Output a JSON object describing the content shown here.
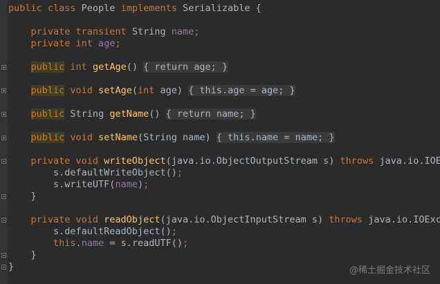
{
  "code": {
    "lines": [
      [
        {
          "t": "public class ",
          "c": "kw"
        },
        {
          "t": "People ",
          "c": "pl"
        },
        {
          "t": "implements ",
          "c": "kw"
        },
        {
          "t": "Serializable {",
          "c": "pl"
        }
      ],
      [],
      [
        {
          "t": "    private transient ",
          "c": "kw"
        },
        {
          "t": "String ",
          "c": "pl"
        },
        {
          "t": "name",
          "c": "fld"
        },
        {
          "t": ";",
          "c": "kw"
        }
      ],
      [
        {
          "t": "    private int ",
          "c": "kw"
        },
        {
          "t": "age",
          "c": "fld"
        },
        {
          "t": ";",
          "c": "kw"
        }
      ],
      [],
      [
        {
          "t": "    ",
          "c": "pl"
        },
        {
          "t": "public",
          "c": "pub"
        },
        {
          "t": " int ",
          "c": "kw"
        },
        {
          "t": "getAge",
          "c": "fn"
        },
        {
          "t": "() ",
          "c": "pl"
        },
        {
          "t": "{ ",
          "c": "fold-region"
        },
        {
          "t": "return ",
          "c": "kw fold-region"
        },
        {
          "t": "age",
          "c": "fld fold-region"
        },
        {
          "t": "; ",
          "c": "kw fold-region"
        },
        {
          "t": "}",
          "c": "fold-region"
        }
      ],
      [],
      [
        {
          "t": "    ",
          "c": "pl"
        },
        {
          "t": "public",
          "c": "pub"
        },
        {
          "t": " void ",
          "c": "kw"
        },
        {
          "t": "setAge",
          "c": "fn"
        },
        {
          "t": "(",
          "c": "pl"
        },
        {
          "t": "int ",
          "c": "kw"
        },
        {
          "t": "age) ",
          "c": "pl"
        },
        {
          "t": "{ ",
          "c": "fold-region"
        },
        {
          "t": "this",
          "c": "kw fold-region"
        },
        {
          "t": ".",
          "c": "fold-region"
        },
        {
          "t": "age",
          "c": "fld fold-region"
        },
        {
          "t": " = age",
          "c": "fold-region"
        },
        {
          "t": "; ",
          "c": "kw fold-region"
        },
        {
          "t": "}",
          "c": "fold-region"
        }
      ],
      [],
      [
        {
          "t": "    ",
          "c": "pl"
        },
        {
          "t": "public",
          "c": "pub"
        },
        {
          "t": " String ",
          "c": "pl"
        },
        {
          "t": "getName",
          "c": "fn"
        },
        {
          "t": "() ",
          "c": "pl"
        },
        {
          "t": "{ ",
          "c": "fold-region"
        },
        {
          "t": "return ",
          "c": "kw fold-region"
        },
        {
          "t": "name",
          "c": "fld fold-region"
        },
        {
          "t": "; ",
          "c": "kw fold-region"
        },
        {
          "t": "}",
          "c": "fold-region"
        }
      ],
      [],
      [
        {
          "t": "    ",
          "c": "pl"
        },
        {
          "t": "public",
          "c": "pub"
        },
        {
          "t": " void ",
          "c": "kw"
        },
        {
          "t": "setName",
          "c": "fn"
        },
        {
          "t": "(String name) ",
          "c": "pl"
        },
        {
          "t": "{ ",
          "c": "fold-region"
        },
        {
          "t": "this",
          "c": "kw fold-region"
        },
        {
          "t": ".",
          "c": "fold-region"
        },
        {
          "t": "name",
          "c": "fld fold-region"
        },
        {
          "t": " = name",
          "c": "fold-region"
        },
        {
          "t": "; ",
          "c": "kw fold-region"
        },
        {
          "t": "}",
          "c": "fold-region"
        }
      ],
      [],
      [
        {
          "t": "    private void ",
          "c": "kw"
        },
        {
          "t": "writeObject",
          "c": "fn"
        },
        {
          "t": "(java.io.ObjectOutputStream s) ",
          "c": "pl"
        },
        {
          "t": "throws ",
          "c": "kw"
        },
        {
          "t": "java.io.IOEx",
          "c": "pl"
        }
      ],
      [
        {
          "t": "        s.defaultWriteObject()",
          "c": "pl"
        },
        {
          "t": ";",
          "c": "kw"
        }
      ],
      [
        {
          "t": "        s.writeUTF(",
          "c": "pl"
        },
        {
          "t": "name",
          "c": "fld"
        },
        {
          "t": ")",
          "c": "pl"
        },
        {
          "t": ";",
          "c": "kw"
        }
      ],
      [
        {
          "t": "    }",
          "c": "pl"
        }
      ],
      [],
      [
        {
          "t": "    private void ",
          "c": "kw"
        },
        {
          "t": "readObject",
          "c": "fn"
        },
        {
          "t": "(java.io.ObjectInputStream s) ",
          "c": "pl"
        },
        {
          "t": "throws ",
          "c": "kw"
        },
        {
          "t": "java.io.IOExce",
          "c": "pl"
        }
      ],
      [
        {
          "t": "        s.defaultReadObject()",
          "c": "pl"
        },
        {
          "t": ";",
          "c": "kw"
        }
      ],
      [
        {
          "t": "        ",
          "c": "pl"
        },
        {
          "t": "this",
          "c": "kw"
        },
        {
          "t": ".",
          "c": "pl"
        },
        {
          "t": "name",
          "c": "fld"
        },
        {
          "t": " = s.readUTF()",
          "c": "pl"
        },
        {
          "t": ";",
          "c": "kw"
        }
      ],
      [
        {
          "t": "    }",
          "c": "pl"
        }
      ],
      [
        {
          "t": "}",
          "c": "pl"
        }
      ]
    ],
    "fold_markers": [
      {
        "line": 5,
        "kind": "plus"
      },
      {
        "line": 7,
        "kind": "plus"
      },
      {
        "line": 9,
        "kind": "plus"
      },
      {
        "line": 11,
        "kind": "plus"
      },
      {
        "line": 13,
        "kind": "minus"
      },
      {
        "line": 16,
        "kind": "minus"
      },
      {
        "line": 18,
        "kind": "minus"
      },
      {
        "line": 21,
        "kind": "minus"
      },
      {
        "line": 22,
        "kind": "minus"
      }
    ]
  },
  "watermark": "@稀土掘金技术社区",
  "colors": {
    "background": "#2b2b2b",
    "keyword": "#cc7832",
    "method": "#ffc66d",
    "field": "#9876aa",
    "text": "#a9b7c6"
  }
}
